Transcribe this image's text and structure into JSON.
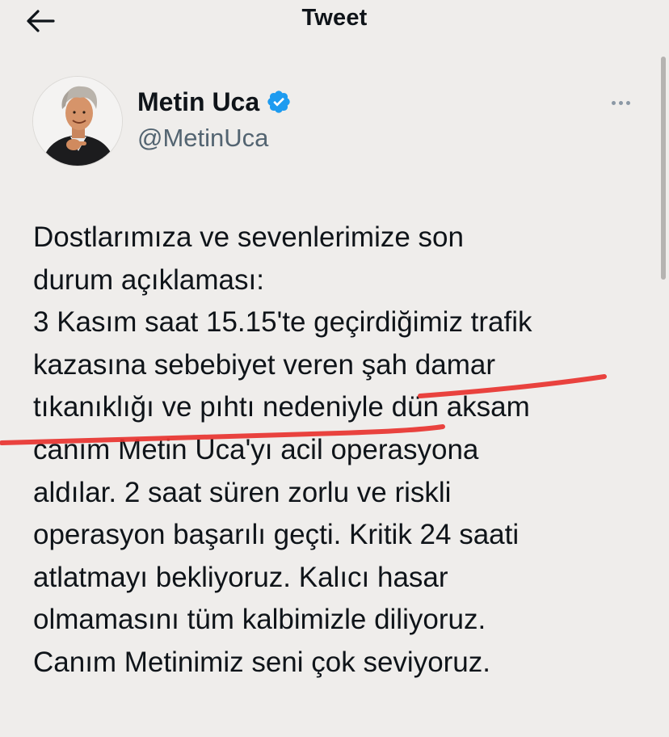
{
  "header": {
    "title": "Tweet",
    "back_icon": "arrow-left-icon"
  },
  "author": {
    "display_name": "Metin Uca",
    "handle": "@MetinUca",
    "verified": true,
    "verified_icon": "verified-badge-icon",
    "verified_color": "#1d9bf0"
  },
  "more_icon": "more-options-icon",
  "tweet": {
    "lines": [
      "Dostlarımıza ve sevenlerimize son",
      "durum açıklaması:",
      "3 Kasım saat 15.15'te geçirdiğimiz trafik",
      "kazasına sebebiyet veren şah damar",
      "tıkanıklığı ve pıhtı nedeniyle dün aksam",
      "canım Metin Uca'yı acil operasyona",
      "aldılar. 2 saat süren zorlu ve riskli",
      "operasyon başarılı geçti. Kritik 24 saati",
      "atlatmayı bekliyoruz. Kalıcı hasar",
      "olmamasını tüm kalbimizle diliyoruz.",
      "Canım Metinimiz seni çok seviyoruz."
    ]
  },
  "annotation": {
    "type": "hand-drawn-underline",
    "color": "#e8332f"
  }
}
